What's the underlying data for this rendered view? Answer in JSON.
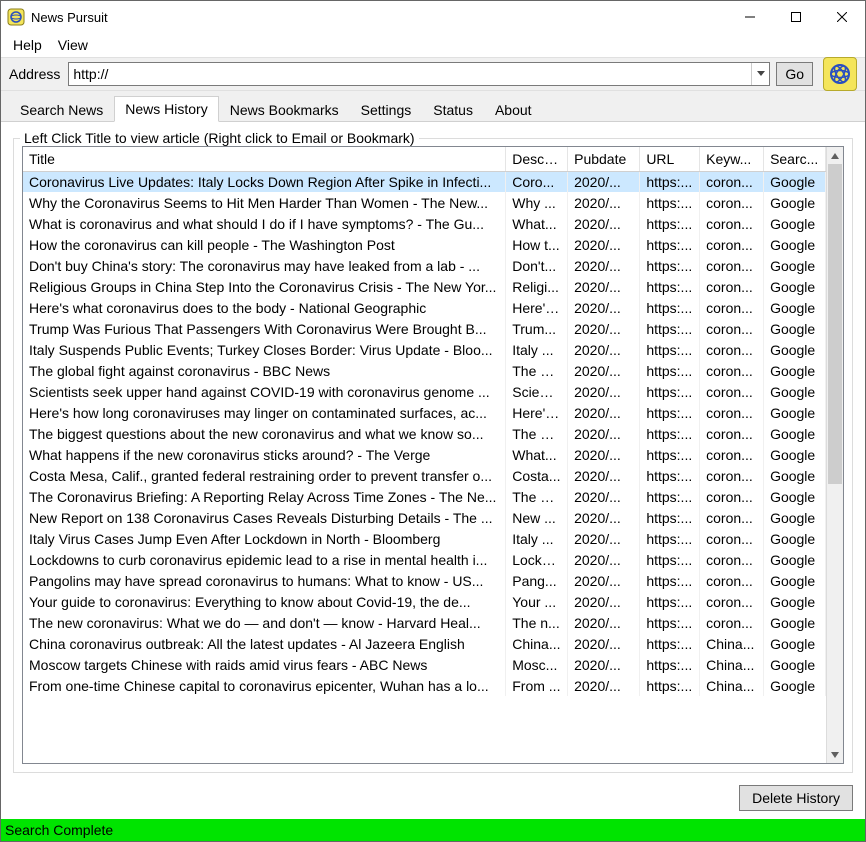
{
  "app": {
    "title": "News Pursuit"
  },
  "menu": {
    "items": [
      "Help",
      "View"
    ]
  },
  "toolbar": {
    "address_label": "Address",
    "address_value": "http://",
    "go_label": "Go"
  },
  "tabs": {
    "items": [
      "Search News",
      "News History",
      "News Bookmarks",
      "Settings",
      "Status",
      "About"
    ],
    "active": 1
  },
  "group_legend": "Left Click Title to view article (Right click to Email or Bookmark)",
  "columns": {
    "title": "Title",
    "description": "Descri...",
    "pubdate": "Pubdate",
    "url": "URL",
    "keywords": "Keyw...",
    "search": "Searc..."
  },
  "rows": [
    {
      "title": "Coronavirus Live Updates: Italy Locks Down Region After Spike in Infecti...",
      "desc": "Coro...",
      "pub": "2020/...",
      "url": "https:...",
      "kw": "coron...",
      "src": "Google"
    },
    {
      "title": "Why the Coronavirus Seems to Hit Men Harder Than Women - The New...",
      "desc": "Why ...",
      "pub": "2020/...",
      "url": "https:...",
      "kw": "coron...",
      "src": "Google"
    },
    {
      "title": "What is coronavirus and what should I do if I have symptoms? - The Gu...",
      "desc": "What...",
      "pub": "2020/...",
      "url": "https:...",
      "kw": "coron...",
      "src": "Google"
    },
    {
      "title": "How the coronavirus can kill people - The Washington Post",
      "desc": "How t...",
      "pub": "2020/...",
      "url": "https:...",
      "kw": "coron...",
      "src": "Google"
    },
    {
      "title": "Don't buy China's story: The coronavirus may have leaked from a lab - ...",
      "desc": "Don't...",
      "pub": "2020/...",
      "url": "https:...",
      "kw": "coron...",
      "src": "Google"
    },
    {
      "title": "Religious Groups in China Step Into the Coronavirus Crisis - The New Yor...",
      "desc": "Religi...",
      "pub": "2020/...",
      "url": "https:...",
      "kw": "coron...",
      "src": "Google"
    },
    {
      "title": "Here's what coronavirus does to the body - National Geographic",
      "desc": "Here's...",
      "pub": "2020/...",
      "url": "https:...",
      "kw": "coron...",
      "src": "Google"
    },
    {
      "title": "Trump Was Furious That Passengers With Coronavirus Were Brought B...",
      "desc": "Trum...",
      "pub": "2020/...",
      "url": "https:...",
      "kw": "coron...",
      "src": "Google"
    },
    {
      "title": "Italy Suspends Public Events; Turkey Closes Border: Virus Update - Bloo...",
      "desc": "Italy ...",
      "pub": "2020/...",
      "url": "https:...",
      "kw": "coron...",
      "src": "Google"
    },
    {
      "title": "The global fight against coronavirus - BBC News",
      "desc": "The gl...",
      "pub": "2020/...",
      "url": "https:...",
      "kw": "coron...",
      "src": "Google"
    },
    {
      "title": "Scientists seek upper hand against COVID-19 with coronavirus genome ...",
      "desc": "Scient...",
      "pub": "2020/...",
      "url": "https:...",
      "kw": "coron...",
      "src": "Google"
    },
    {
      "title": "Here's how long coronaviruses may linger on contaminated surfaces, ac...",
      "desc": "Here's...",
      "pub": "2020/...",
      "url": "https:...",
      "kw": "coron...",
      "src": "Google"
    },
    {
      "title": "The biggest questions about the new coronavirus and what we know so...",
      "desc": "The bi...",
      "pub": "2020/...",
      "url": "https:...",
      "kw": "coron...",
      "src": "Google"
    },
    {
      "title": "What happens if the new coronavirus sticks around? - The Verge",
      "desc": "What...",
      "pub": "2020/...",
      "url": "https:...",
      "kw": "coron...",
      "src": "Google"
    },
    {
      "title": "Costa Mesa, Calif., granted federal restraining order to prevent transfer o...",
      "desc": "Costa...",
      "pub": "2020/...",
      "url": "https:...",
      "kw": "coron...",
      "src": "Google"
    },
    {
      "title": "The Coronavirus Briefing: A Reporting Relay Across Time Zones - The Ne...",
      "desc": "The C...",
      "pub": "2020/...",
      "url": "https:...",
      "kw": "coron...",
      "src": "Google"
    },
    {
      "title": "New Report on 138 Coronavirus Cases Reveals Disturbing Details - The ...",
      "desc": "New ...",
      "pub": "2020/...",
      "url": "https:...",
      "kw": "coron...",
      "src": "Google"
    },
    {
      "title": "Italy Virus Cases Jump Even After Lockdown in North - Bloomberg",
      "desc": "Italy ...",
      "pub": "2020/...",
      "url": "https:...",
      "kw": "coron...",
      "src": "Google"
    },
    {
      "title": "Lockdowns to curb coronavirus epidemic lead to a rise in mental health i...",
      "desc": "Lockd...",
      "pub": "2020/...",
      "url": "https:...",
      "kw": "coron...",
      "src": "Google"
    },
    {
      "title": "Pangolins may have spread coronavirus to humans: What to know - US...",
      "desc": "Pang...",
      "pub": "2020/...",
      "url": "https:...",
      "kw": "coron...",
      "src": "Google"
    },
    {
      "title": "Your guide to coronavirus: Everything to know about Covid-19, the de...",
      "desc": "Your ...",
      "pub": "2020/...",
      "url": "https:...",
      "kw": "coron...",
      "src": "Google"
    },
    {
      "title": "The new coronavirus: What we do — and don't — know - Harvard Heal...",
      "desc": "The n...",
      "pub": "2020/...",
      "url": "https:...",
      "kw": "coron...",
      "src": "Google"
    },
    {
      "title": "China coronavirus outbreak: All the latest updates - Al Jazeera English",
      "desc": "China...",
      "pub": "2020/...",
      "url": "https:...",
      "kw": "China...",
      "src": "Google"
    },
    {
      "title": "Moscow targets Chinese with raids amid virus fears - ABC News",
      "desc": "Mosc...",
      "pub": "2020/...",
      "url": "https:...",
      "kw": "China...",
      "src": "Google"
    },
    {
      "title": "From one-time Chinese capital to coronavirus epicenter, Wuhan has a lo...",
      "desc": "From ...",
      "pub": "2020/...",
      "url": "https:...",
      "kw": "China...",
      "src": "Google"
    }
  ],
  "footer": {
    "delete_label": "Delete History"
  },
  "status": {
    "text": "Search Complete"
  }
}
